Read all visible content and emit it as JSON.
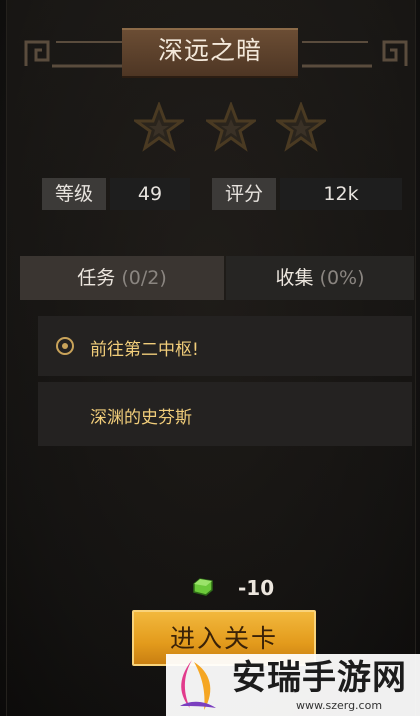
{
  "level": {
    "title": "深远之暗",
    "stars_earned": 0,
    "stars_total": 3
  },
  "stats": {
    "grade_label": "等级",
    "grade_value": "49",
    "score_label": "评分",
    "score_value": "12k"
  },
  "tabs": [
    {
      "label": "任务",
      "count": "(0/2)",
      "active": true
    },
    {
      "label": "收集",
      "count": "(0%)",
      "active": false
    }
  ],
  "quests": [
    {
      "text": "前往第二中枢!",
      "has_icon": true
    },
    {
      "text": "深渊的史芬斯",
      "has_icon": false
    }
  ],
  "cost": {
    "icon": "green-gem-icon",
    "value": "-10"
  },
  "enter_button": {
    "label": "进入关卡"
  },
  "watermark": {
    "title": "安瑞手游网",
    "url": "www.szerg.com"
  },
  "colors": {
    "accent": "#e39b1c",
    "title_bar": "#5b412b",
    "quest_text": "#f1cd7a",
    "star_outline": "#4a3a22"
  }
}
